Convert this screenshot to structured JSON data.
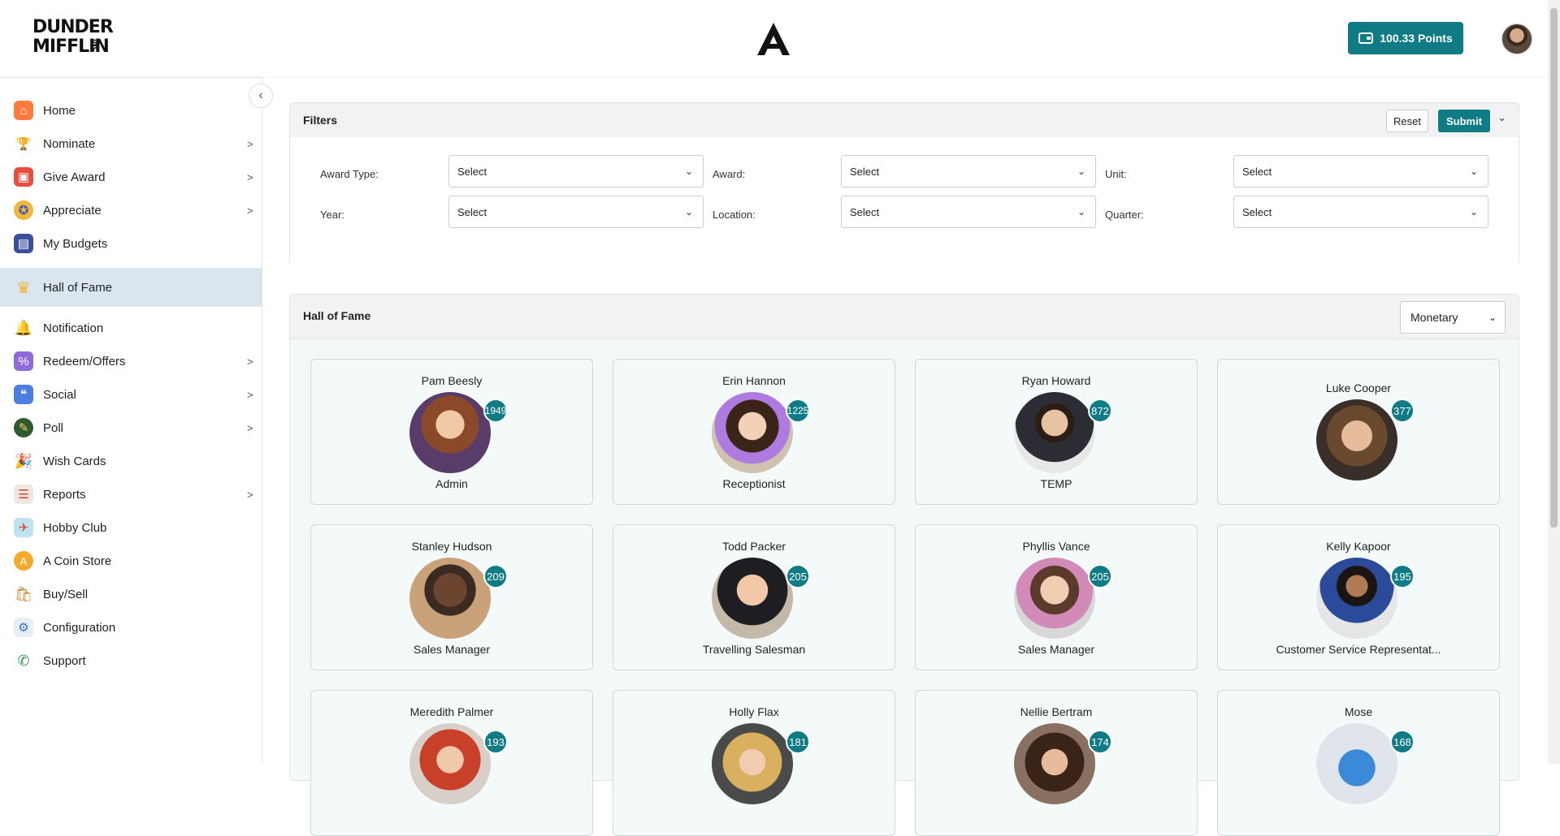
{
  "header": {
    "brand_line1": "DUNDER",
    "brand_line2": "MIFFLIN",
    "brand_suffix": "INC",
    "points_label": "100.33 Points",
    "accent": "#0f7c85"
  },
  "sidebar": {
    "items": [
      {
        "label": "Home",
        "icon": "home-icon",
        "chev": ""
      },
      {
        "label": "Nominate",
        "icon": "trophy-icon",
        "chev": ">"
      },
      {
        "label": "Give Award",
        "icon": "gift-icon",
        "chev": ">"
      },
      {
        "label": "Appreciate",
        "icon": "medal-icon",
        "chev": ">"
      },
      {
        "label": "My Budgets",
        "icon": "wallet-icon",
        "chev": ""
      },
      {
        "label": "Hall of Fame",
        "icon": "crown-icon",
        "chev": ""
      },
      {
        "label": "Notification",
        "icon": "bell-icon",
        "chev": ""
      },
      {
        "label": "Redeem/Offers",
        "icon": "offers-icon",
        "chev": ">"
      },
      {
        "label": "Social",
        "icon": "social-icon",
        "chev": ">"
      },
      {
        "label": "Poll",
        "icon": "poll-icon",
        "chev": ">"
      },
      {
        "label": "Wish Cards",
        "icon": "party-icon",
        "chev": ""
      },
      {
        "label": "Reports",
        "icon": "report-icon",
        "chev": ">"
      },
      {
        "label": "Hobby Club",
        "icon": "hobby-icon",
        "chev": ""
      },
      {
        "label": "A Coin Store",
        "icon": "coin-icon",
        "chev": ""
      },
      {
        "label": "Buy/Sell",
        "icon": "shopping-icon",
        "chev": ""
      },
      {
        "label": "Configuration",
        "icon": "config-icon",
        "chev": ""
      },
      {
        "label": "Support",
        "icon": "phone-icon",
        "chev": ""
      }
    ],
    "active": "Hall of Fame"
  },
  "filters": {
    "title": "Filters",
    "reset_label": "Reset",
    "submit_label": "Submit",
    "award_type_label": "Award Type:",
    "award_label": "Award:",
    "unit_label": "Unit:",
    "year_label": "Year:",
    "location_label": "Location:",
    "quarter_label": "Quarter:",
    "select_placeholder": "Select"
  },
  "hof": {
    "title": "Hall of Fame",
    "type_selected": "Monetary",
    "cards": [
      {
        "name": "Pam Beesly",
        "points": "1949",
        "role": "Admin"
      },
      {
        "name": "Erin Hannon",
        "points": "1225",
        "role": "Receptionist"
      },
      {
        "name": "Ryan Howard",
        "points": "872",
        "role": "TEMP"
      },
      {
        "name": "Luke Cooper",
        "points": "377",
        "role": ""
      },
      {
        "name": "Stanley Hudson",
        "points": "209",
        "role": "Sales Manager"
      },
      {
        "name": "Todd Packer",
        "points": "205",
        "role": "Travelling Salesman"
      },
      {
        "name": "Phyllis Vance",
        "points": "205",
        "role": "Sales Manager"
      },
      {
        "name": "Kelly Kapoor",
        "points": "195",
        "role": "Customer Service Representat..."
      },
      {
        "name": "Meredith Palmer",
        "points": "193",
        "role": ""
      },
      {
        "name": "Holly Flax",
        "points": "181",
        "role": ""
      },
      {
        "name": "Nellie Bertram",
        "points": "174",
        "role": ""
      },
      {
        "name": "Mose",
        "points": "168",
        "role": ""
      }
    ]
  }
}
